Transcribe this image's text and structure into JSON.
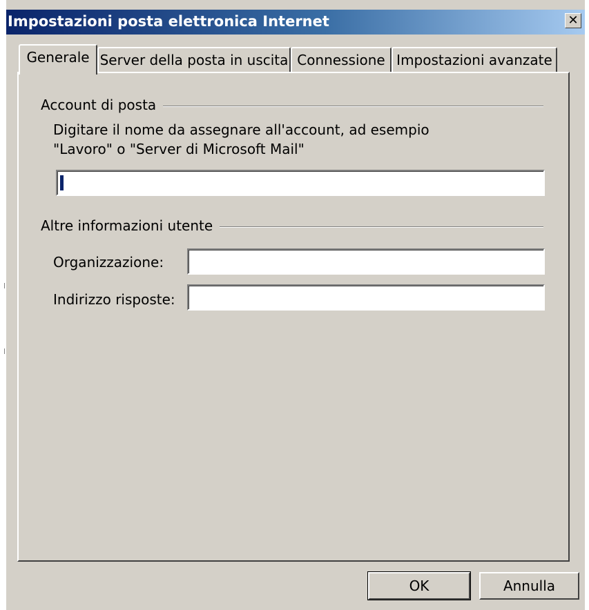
{
  "window": {
    "title": "Impostazioni posta elettronica Internet",
    "close_glyph": "✕"
  },
  "tabs": [
    {
      "label": "Generale",
      "active": true
    },
    {
      "label": "Server della posta in uscita",
      "active": false
    },
    {
      "label": "Connessione",
      "active": false
    },
    {
      "label": "Impostazioni avanzate",
      "active": false
    }
  ],
  "account_group": {
    "label": "Account di posta",
    "description_line1": "Digitare il nome da assegnare all'account, ad esempio",
    "description_line2": "\"Lavoro\" o \"Server di Microsoft Mail\"",
    "account_name_value": ""
  },
  "user_info_group": {
    "label": "Altre informazioni utente",
    "organization_label": "Organizzazione:",
    "organization_value": "",
    "reply_address_label": "Indirizzo risposte:",
    "reply_address_value": ""
  },
  "buttons": {
    "ok": "OK",
    "cancel": "Annulla"
  },
  "colors": {
    "dialog_face": "#d4d0c8",
    "titlebar_start": "#0a246a",
    "titlebar_end": "#a6caf0",
    "title_text": "#ffffff"
  }
}
